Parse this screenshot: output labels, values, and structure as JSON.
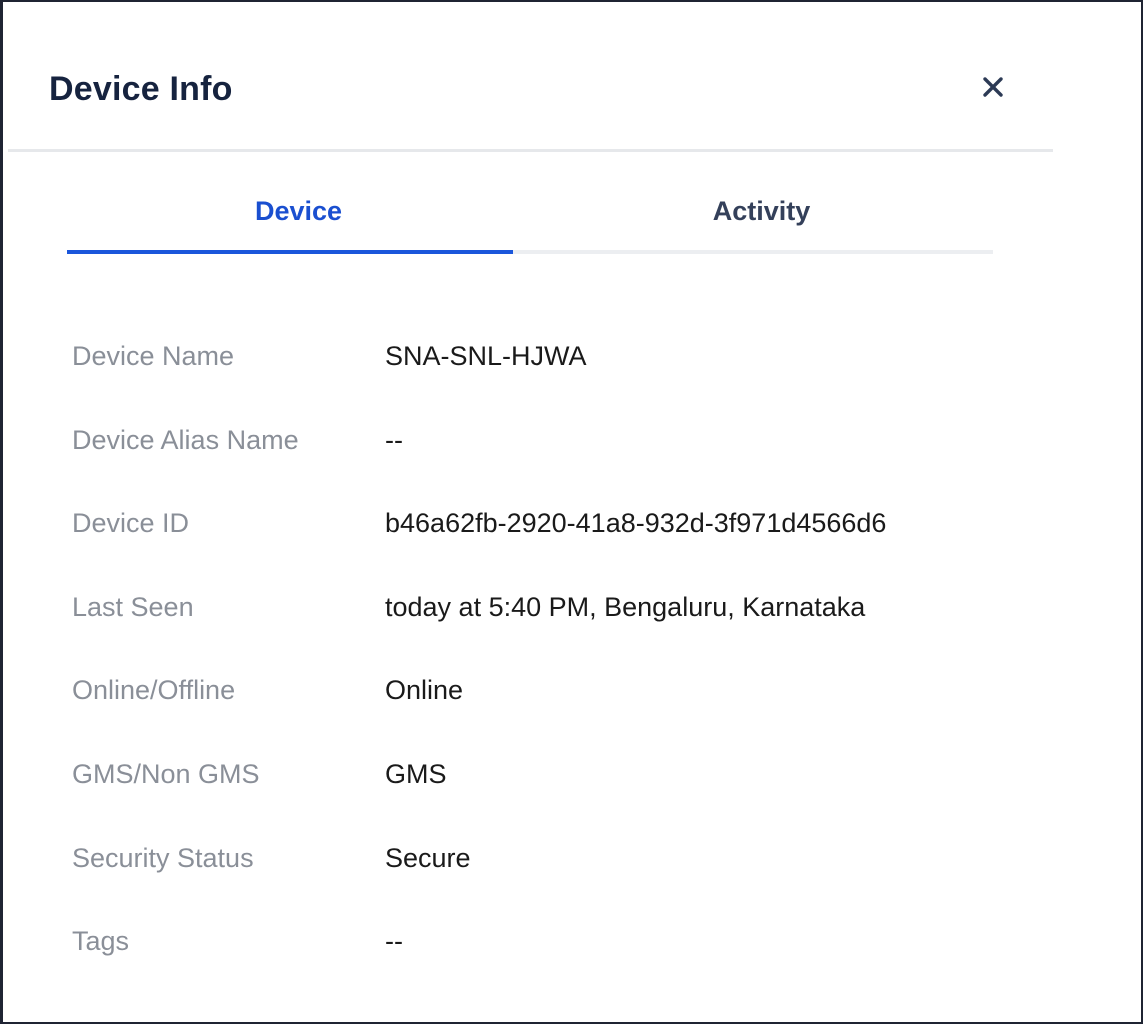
{
  "header": {
    "title": "Device Info",
    "close_icon": "close-icon"
  },
  "tabs": [
    {
      "label": "Device",
      "active": true
    },
    {
      "label": "Activity",
      "active": false
    }
  ],
  "details": [
    {
      "label": "Device Name",
      "value": "SNA-SNL-HJWA"
    },
    {
      "label": "Device Alias Name",
      "value": "--"
    },
    {
      "label": "Device ID",
      "value": "b46a62fb-2920-41a8-932d-3f971d4566d6"
    },
    {
      "label": "Last Seen",
      "value": "today at 5:40 PM, Bengaluru, Karnataka"
    },
    {
      "label": "Online/Offline",
      "value": "Online"
    },
    {
      "label": "GMS/Non GMS",
      "value": "GMS"
    },
    {
      "label": "Security Status",
      "value": "Secure"
    },
    {
      "label": "Tags",
      "value": "--"
    }
  ],
  "colors": {
    "title": "#16233f",
    "active_tab": "#1a4fd0",
    "tab_indicator": "#1a56db",
    "inactive_tab": "#34405a",
    "label": "#8a8f98",
    "value": "#1a1a1a"
  }
}
